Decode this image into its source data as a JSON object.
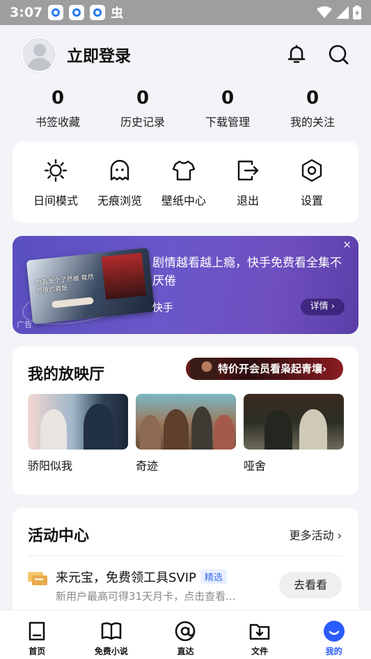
{
  "status_bar": {
    "time": "3:07",
    "bug_glyph": "虫"
  },
  "header": {
    "login": "立即登录"
  },
  "stats": [
    {
      "value": "0",
      "label": "书签收藏"
    },
    {
      "value": "0",
      "label": "历史记录"
    },
    {
      "value": "0",
      "label": "下载管理"
    },
    {
      "value": "0",
      "label": "我的关注"
    }
  ],
  "tools": [
    {
      "label": "日间模式",
      "icon": "sun-icon"
    },
    {
      "label": "无痕浏览",
      "icon": "ghost-icon"
    },
    {
      "label": "壁纸中心",
      "icon": "shirt-icon"
    },
    {
      "label": "退出",
      "icon": "exit-icon"
    },
    {
      "label": "设置",
      "icon": "settings-icon"
    }
  ],
  "ad": {
    "text": "剧情越看越上瘾，快手免费看全集不厌倦",
    "brand": "快手",
    "detail": "详情 ›",
    "label": "广告",
    "close": "✕",
    "poster_text": "她若是个了然被 竟然将敬的竟是"
  },
  "theater": {
    "title": "我的放映厅",
    "banner": "特价开会员看枭起青壤›",
    "items": [
      {
        "name": "骄阳似我"
      },
      {
        "name": "奇迹"
      },
      {
        "name": "哑舍"
      }
    ]
  },
  "activity": {
    "title": "活动中心",
    "more": "更多活动 ›",
    "item": {
      "title": "来元宝，免费领工具SVIP",
      "tag": "精选",
      "subtitle": "新用户最高可得31天月卡，点击查看...",
      "button": "去看看"
    }
  },
  "bottom_nav": [
    {
      "label": "首页",
      "icon": "home-icon"
    },
    {
      "label": "免费小说",
      "icon": "book-icon"
    },
    {
      "label": "直达",
      "icon": "at-icon"
    },
    {
      "label": "文件",
      "icon": "folder-download-icon"
    },
    {
      "label": "我的",
      "icon": "profile-smile-icon",
      "active": true
    }
  ],
  "colors": {
    "accent": "#2a5bff",
    "ad_purple": "#6a57c9",
    "tag_blue": "#3a6fe8"
  }
}
